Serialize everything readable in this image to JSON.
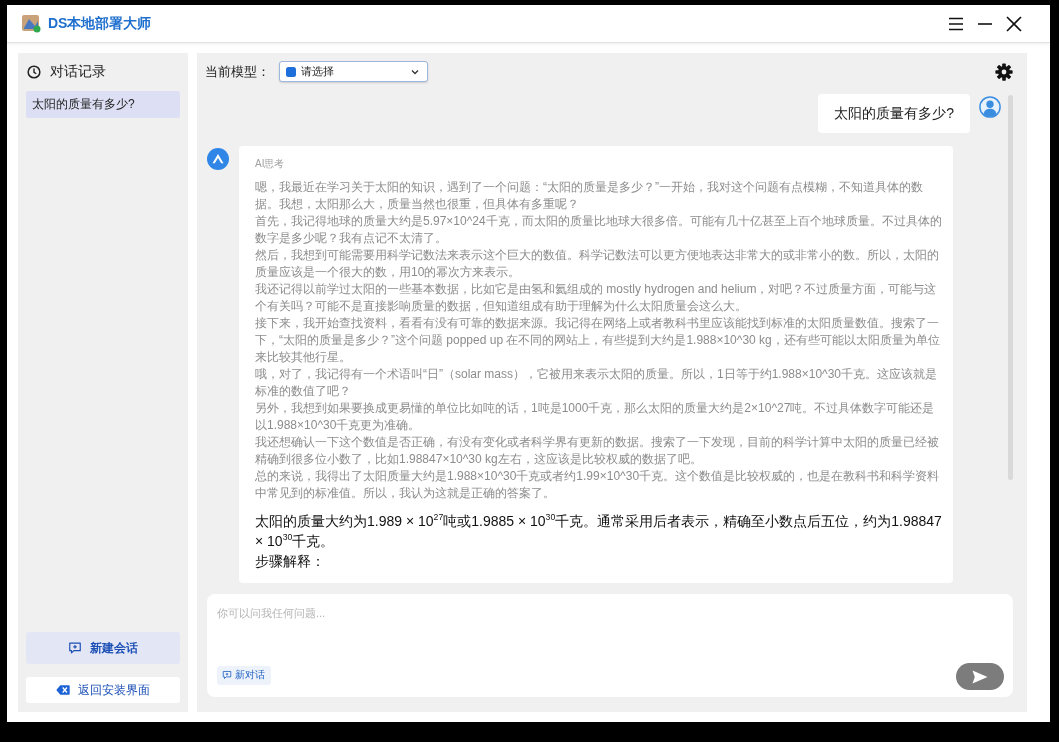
{
  "window": {
    "title": "DS本地部署大师"
  },
  "sidebar": {
    "header": "对话记录",
    "items": [
      {
        "label": "太阳的质量有多少?",
        "selected": true
      }
    ],
    "buttons": [
      {
        "label": "新建会话",
        "kind": "primary"
      },
      {
        "label": "返回安装界面",
        "kind": "secondary"
      }
    ]
  },
  "toolbar": {
    "model_label": "当前模型：",
    "model_select": {
      "value": "请选择"
    }
  },
  "messages": [
    {
      "kind": "user",
      "text": "太阳的质量有多少?"
    },
    {
      "kind": "assistant",
      "thinking_label": "AI思考",
      "thinking": [
        "嗯，我最近在学习关于太阳的知识，遇到了一个问题：“太阳的质量是多少？”一开始，我对这个问题有点模糊，不知道具体的数据。我想，太阳那么大，质量当然也很重，但具体有多重呢？",
        "首先，我记得地球的质量大约是5.97×10^24千克，而太阳的质量比地球大很多倍。可能有几十亿甚至上百个地球质量。不过具体的数字是多少呢？我有点记不太清了。",
        "然后，我想到可能需要用科学记数法来表示这个巨大的数值。科学记数法可以更方便地表达非常大的或非常小的数。所以，太阳的质量应该是一个很大的数，用10的幂次方来表示。",
        "我还记得以前学过太阳的一些基本数据，比如它是由氢和氦组成的 mostly hydrogen and helium，对吧？不过质量方面，可能与这个有关吗？可能不是直接影响质量的数据，但知道组成有助于理解为什么太阳质量会这么大。",
        "接下来，我开始查找资料，看看有没有可靠的数据来源。我记得在网络上或者教科书里应该能找到标准的太阳质量数值。搜索了一下，“太阳的质量是多少？”这个问题 popped up 在不同的网站上，有些提到大约是1.988×10^30 kg，还有些可能以太阳质量为单位来比较其他行星。",
        "哦，对了，我记得有一个术语叫“日”（solar mass），它被用来表示太阳的质量。所以，1日等于约1.988×10^30千克。这应该就是标准的数值了吧？",
        "另外，我想到如果要换成更易懂的单位比如吨的话，1吨是1000千克，那么太阳的质量大约是2×10^27吨。不过具体数字可能还是以1.988×10^30千克更为准确。",
        "我还想确认一下这个数值是否正确，有没有变化或者科学界有更新的数据。搜索了一下发现，目前的科学计算中太阳的质量已经被精确到很多位小数了，比如1.98847×10^30 kg左右，这应该是比较权威的数据了吧。",
        "总的来说，我得出了太阳质量大约是1.988×10^30千克或者约1.99×10^30千克。这个数值是比较权威的，也是在教科书和科学资料中常见到的标准值。所以，我认为这就是正确的答案了。"
      ],
      "answer": [
        "太阳的质量大约为1.989 × 10$^{27}$吨或1.9885 × 10$^{30}$千克。通常采用后者表示，精确至小数点后五位，约为1.98847 × 10$^{30}$千克。",
        "步骤解释："
      ]
    }
  ],
  "input": {
    "placeholder": "你可以问我任何问题...",
    "new_chat_button": "新对话"
  }
}
